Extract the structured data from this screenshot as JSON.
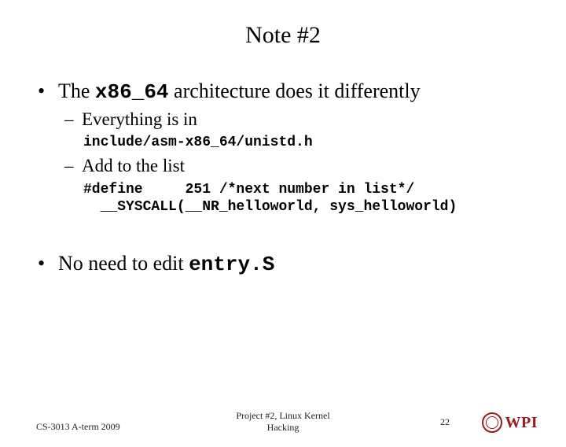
{
  "title": "Note #2",
  "bullets": [
    {
      "pre": "The ",
      "code": "x86_64",
      "post": " architecture does it differently",
      "subs": [
        {
          "text": "Everything is in",
          "code": "include/asm-x86_64/unistd.h"
        },
        {
          "text": "Add to the list",
          "code": "#define     251 /*next number in list*/\n  __SYSCALL(__NR_helloworld, sys_helloworld)"
        }
      ]
    },
    {
      "pre": "No need to edit ",
      "code": "entry.S",
      "post": "",
      "subs": []
    }
  ],
  "footer": {
    "left": "CS-3013 A-term 2009",
    "center_line1": "Project #2, Linux Kernel",
    "center_line2": "Hacking",
    "pagenum": "22",
    "logo_text": "WPI"
  }
}
